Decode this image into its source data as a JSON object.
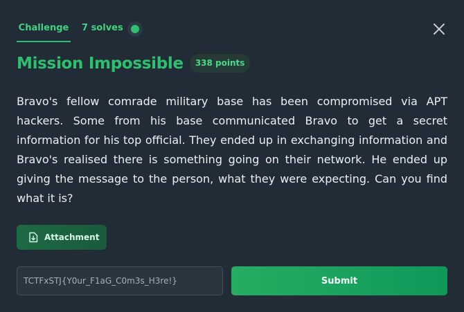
{
  "tabs": {
    "challenge_label": "Challenge",
    "solves_label": "7 solves"
  },
  "challenge": {
    "title": "Mission Impossible",
    "points": "338 points",
    "description": "Bravo's fellow comrade military base has been compromised via APT hackers. Some from his base communicated Bravo to get a secret information for his top official. They ended up in exchanging information and Bravo's realised there is something going on their network. He ended up giving the message to the person, what they were expecting. Can you find what it is?"
  },
  "attachment": {
    "label": "Attachment"
  },
  "flag": {
    "placeholder": "TCTFxSTJ{Y0ur_F1aG_C0m3s_H3re!}",
    "value": ""
  },
  "submit": {
    "label": "Submit"
  },
  "icons": {
    "close": "close-icon",
    "attachment": "file-download-icon",
    "solves_indicator": "status-dot-icon"
  },
  "colors": {
    "background": "#222c37",
    "accent_green": "#2fc06f",
    "badge_bg": "#263b36",
    "attachment_bg": "#1d6b45",
    "submit_bg": "#26ad62",
    "input_bg": "#2b3540"
  }
}
